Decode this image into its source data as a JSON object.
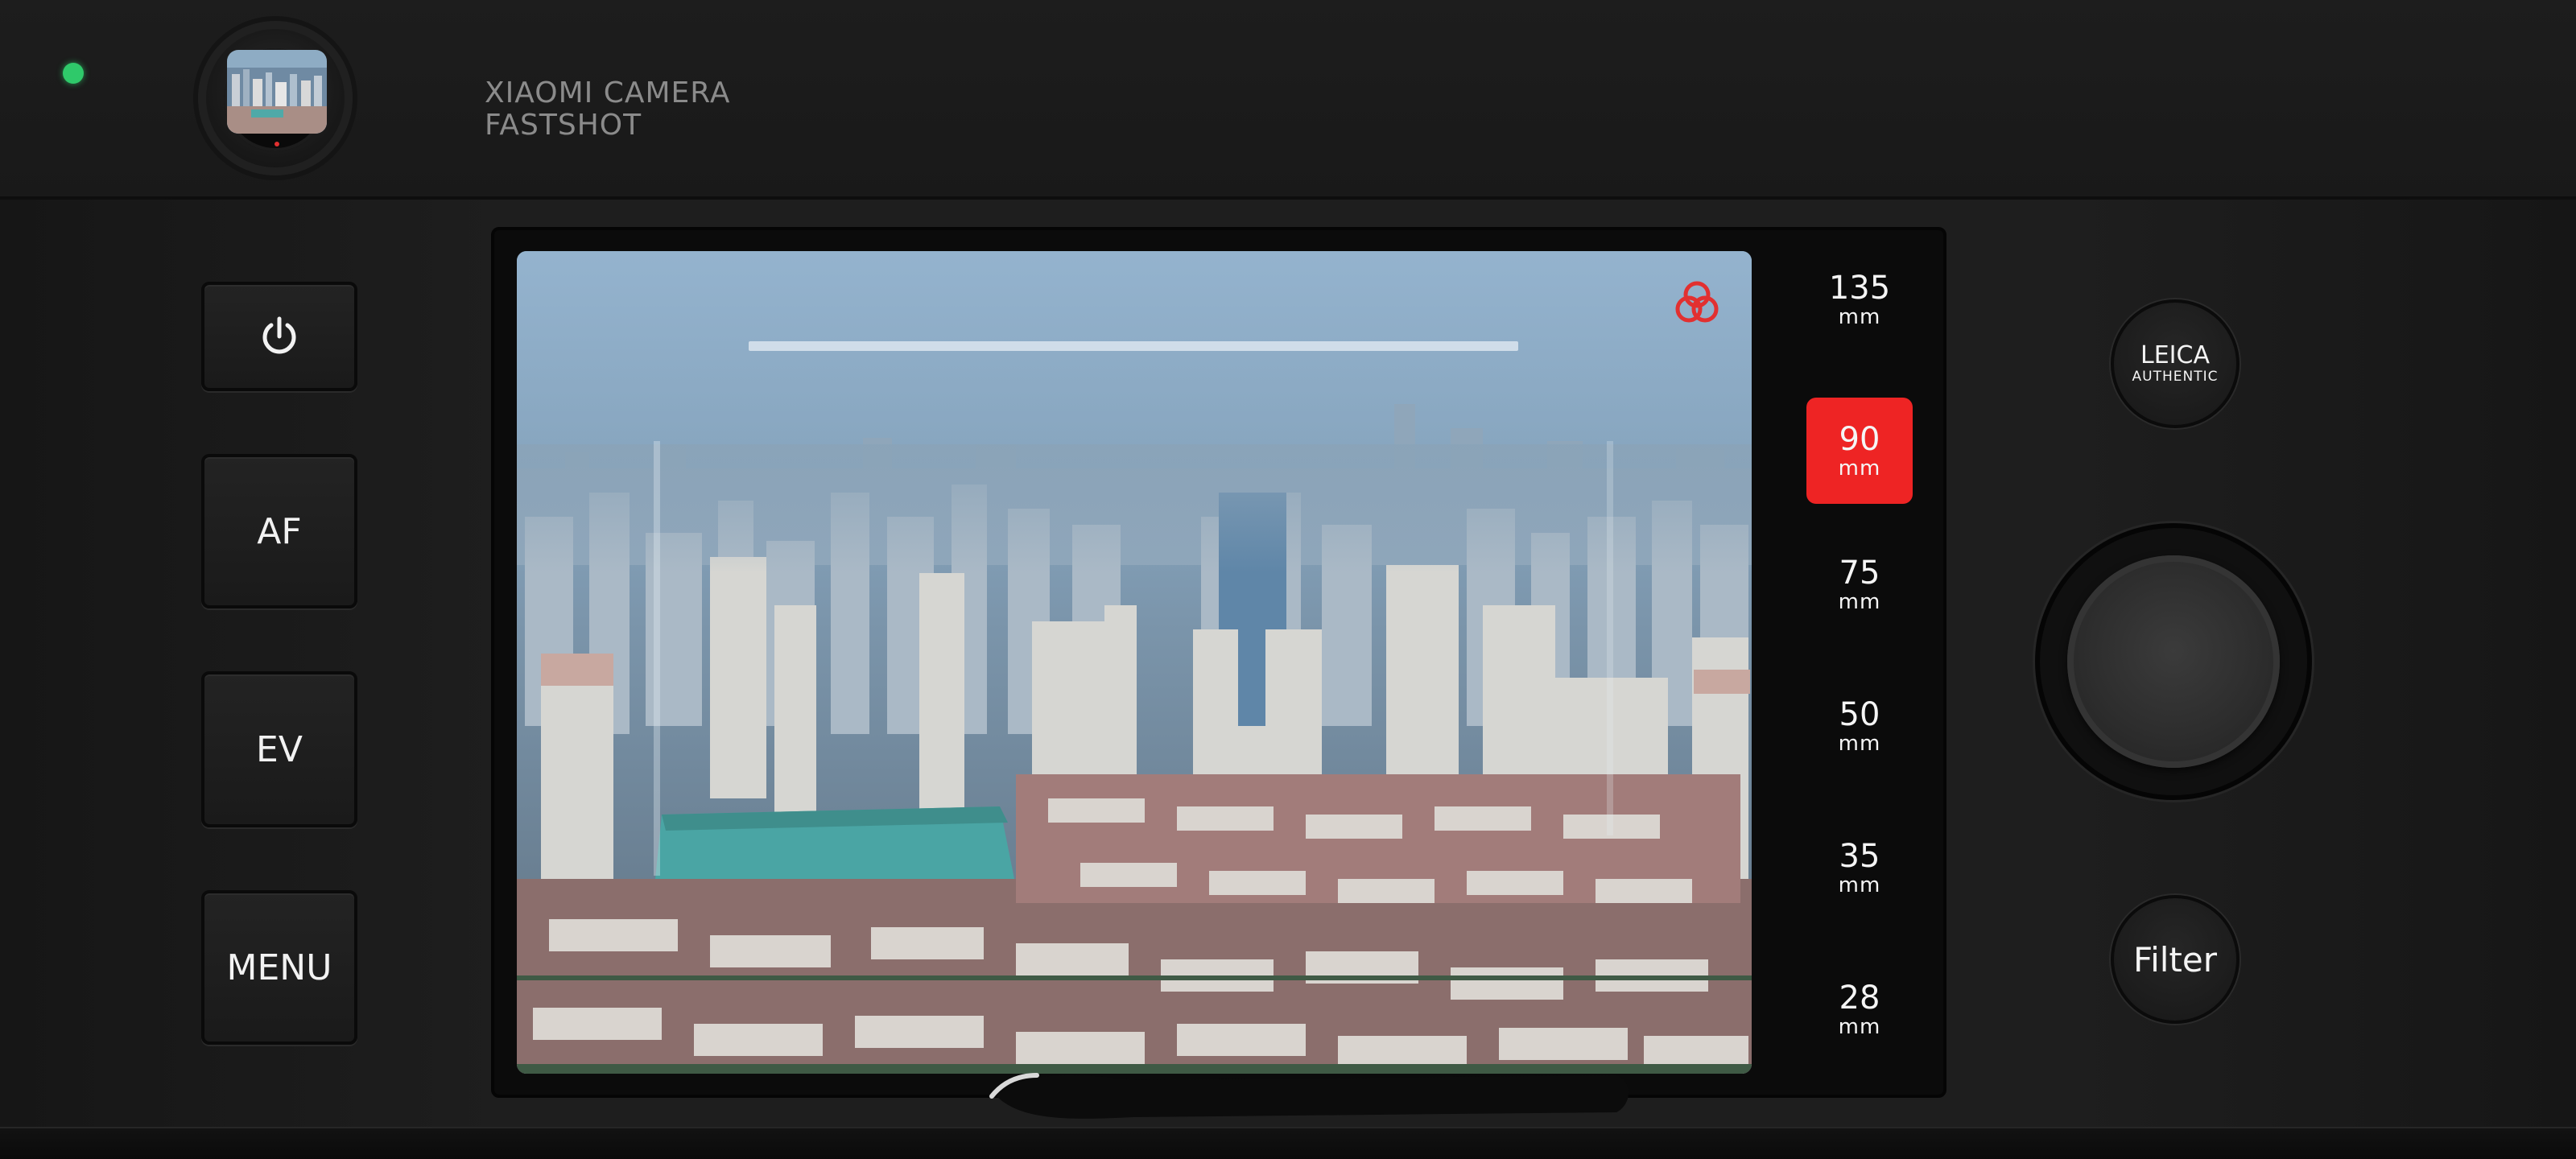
{
  "status": {
    "indicator_color": "#2fc96a"
  },
  "brand": {
    "line1": "XIAOMI CAMERA",
    "line2": "FASTSHOT"
  },
  "left_buttons": {
    "power_icon": "power-icon",
    "af_label": "AF",
    "ev_label": "EV",
    "menu_label": "MENU"
  },
  "viewfinder": {
    "scene": "city skyline with high-rise buildings",
    "filter_icon": "color-filter-icon",
    "filter_icon_color": "#e23030"
  },
  "focal_lengths": {
    "unit": "mm",
    "items": [
      {
        "value": "135",
        "active": false
      },
      {
        "value": "90",
        "active": true
      },
      {
        "value": "75",
        "active": false
      },
      {
        "value": "50",
        "active": false
      },
      {
        "value": "35",
        "active": false
      },
      {
        "value": "28",
        "active": false
      }
    ],
    "active_color": "#ee2424"
  },
  "right_controls": {
    "leica_line1": "LEICA",
    "leica_line2": "AUTHENTIC",
    "filter_label": "Filter",
    "shutter_icon": "shutter-button"
  }
}
